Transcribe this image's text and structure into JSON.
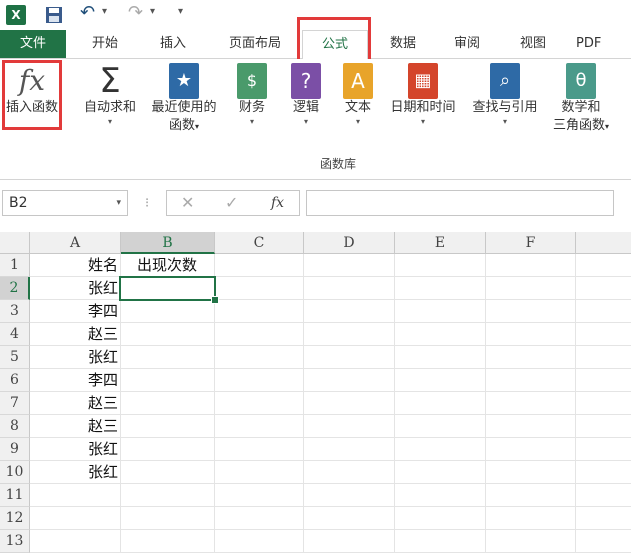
{
  "quick_access": {
    "undo_icon": "↶",
    "redo_icon": "↷",
    "dropdown_icon": "▾"
  },
  "tabs": [
    "文件",
    "开始",
    "插入",
    "页面布局",
    "公式",
    "数据",
    "审阅",
    "视图",
    "PDF"
  ],
  "ribbon": {
    "buttons": [
      {
        "label": "插入函数",
        "icon": "fx",
        "caret": ""
      },
      {
        "label": "自动求和",
        "icon": "Σ",
        "caret": "▾"
      },
      {
        "label": "最近使用的",
        "label2": "函数",
        "icon": "★",
        "caret": "▾"
      },
      {
        "label": "财务",
        "icon": "$",
        "caret": "▾"
      },
      {
        "label": "逻辑",
        "icon": "?",
        "caret": "▾"
      },
      {
        "label": "文本",
        "icon": "A",
        "caret": "▾"
      },
      {
        "label": "日期和时间",
        "icon": "▦",
        "caret": "▾"
      },
      {
        "label": "查找与引用",
        "icon": "⌕",
        "caret": "▾"
      },
      {
        "label": "数学和",
        "label2": "三角函数",
        "icon": "θ",
        "caret": "▾"
      }
    ],
    "group_label": "函数库"
  },
  "formula_bar": {
    "name_box": "B2",
    "cancel": "✕",
    "enter": "✓",
    "fx": "fx",
    "sep": "⁝",
    "formula": ""
  },
  "columns": [
    "A",
    "B",
    "C",
    "D",
    "E",
    "F"
  ],
  "rows": [
    "1",
    "2",
    "3",
    "4",
    "5",
    "6",
    "7",
    "8",
    "9",
    "10",
    "11",
    "12",
    "13"
  ],
  "cells": {
    "A": [
      "姓名",
      "张红",
      "李四",
      "赵三",
      "张红",
      "李四",
      "赵三",
      "赵三",
      "张红",
      "张红"
    ],
    "B1": "出现次数"
  },
  "selected": {
    "cell": "B2",
    "column": "B",
    "row": "2"
  },
  "colors": {
    "accent": "#217346",
    "highlight": "#e23a3a"
  }
}
